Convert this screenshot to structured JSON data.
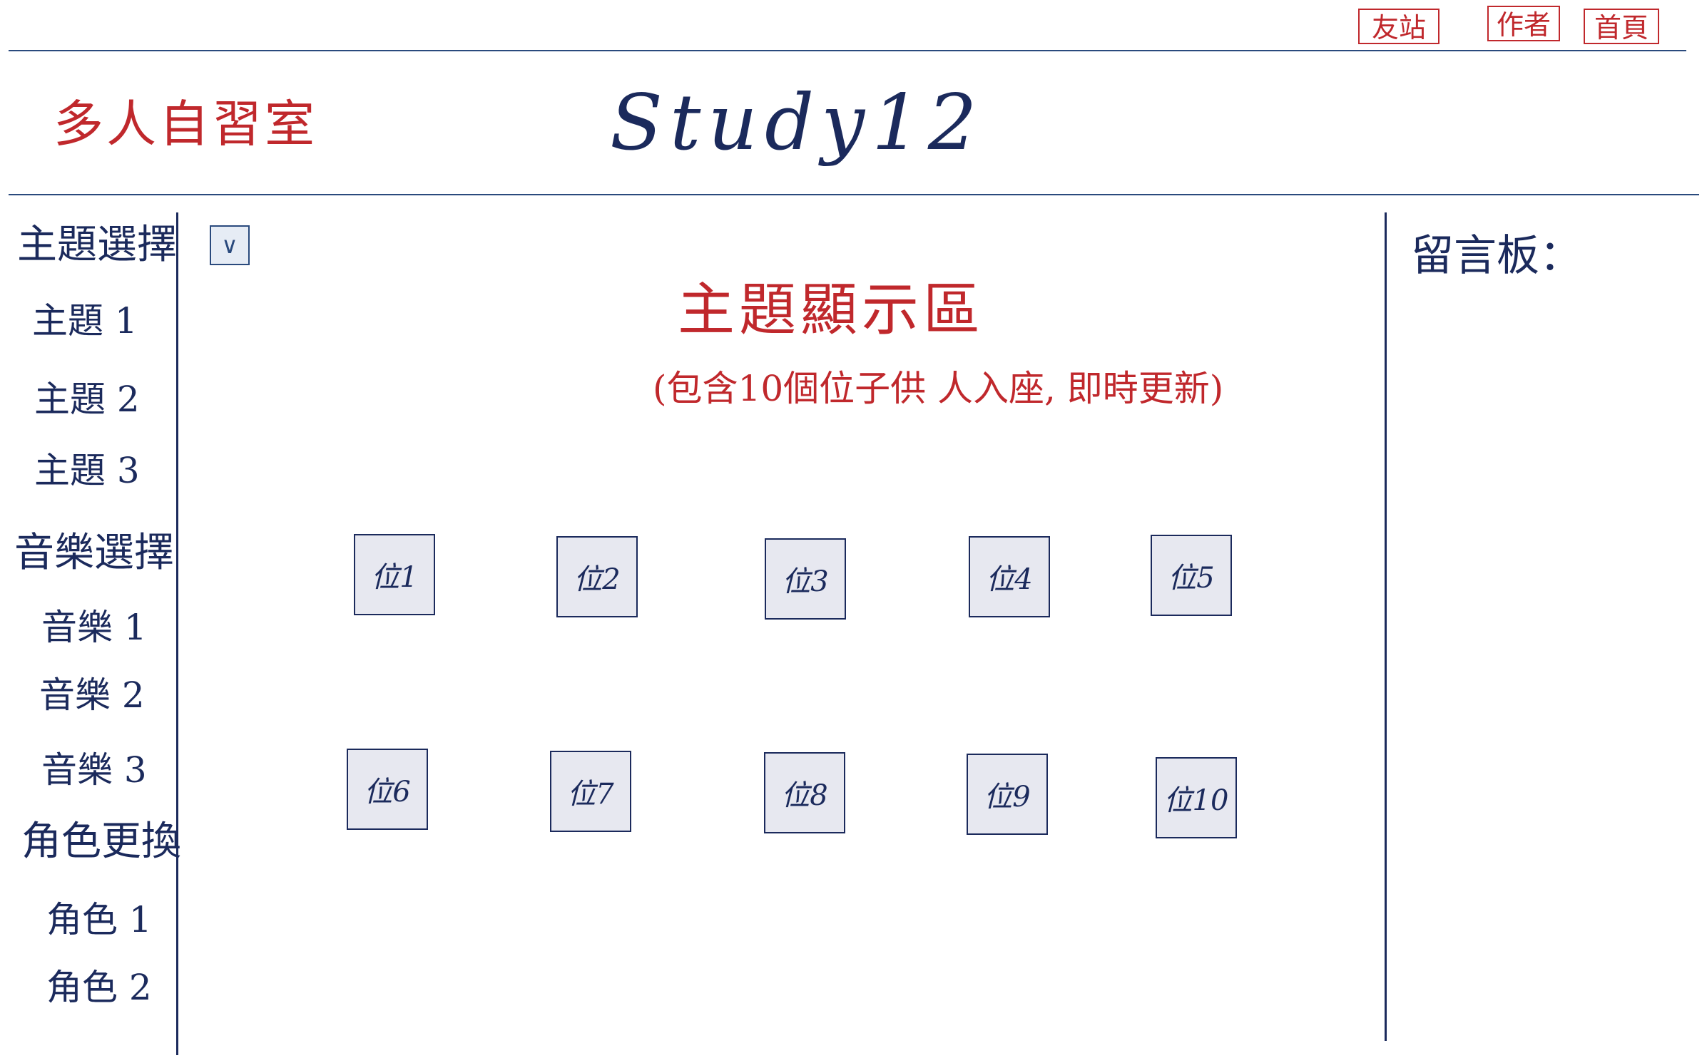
{
  "nav": {
    "friend_sites": "友站",
    "author": "作者",
    "home": "首頁"
  },
  "header": {
    "brand": "多人自習室",
    "site_title": "Study12"
  },
  "sidebar": {
    "topic_heading": "主題選擇",
    "topics": [
      "主題 1",
      "主題 2",
      "主題 3"
    ],
    "music_heading": "音樂選擇",
    "music": [
      "音樂 1",
      "音樂 2",
      "音樂 3"
    ],
    "role_heading": "角色更換",
    "roles": [
      "角色 1",
      "角色 2"
    ]
  },
  "main": {
    "dropdown_icon": "∨",
    "topic_display": "主題顯示區",
    "topic_note": "(包含10個位子供 人入座, 即時更新)",
    "seats": [
      "位1",
      "位2",
      "位3",
      "位4",
      "位5",
      "位6",
      "位7",
      "位8",
      "位9",
      "位10"
    ]
  },
  "message_board": {
    "label": "留言板："
  },
  "colors": {
    "accent_red": "#c0282c",
    "ink_navy": "#1b2a5c",
    "line_blue": "#2a4a7d",
    "seat_fill": "#e7e8f0"
  }
}
